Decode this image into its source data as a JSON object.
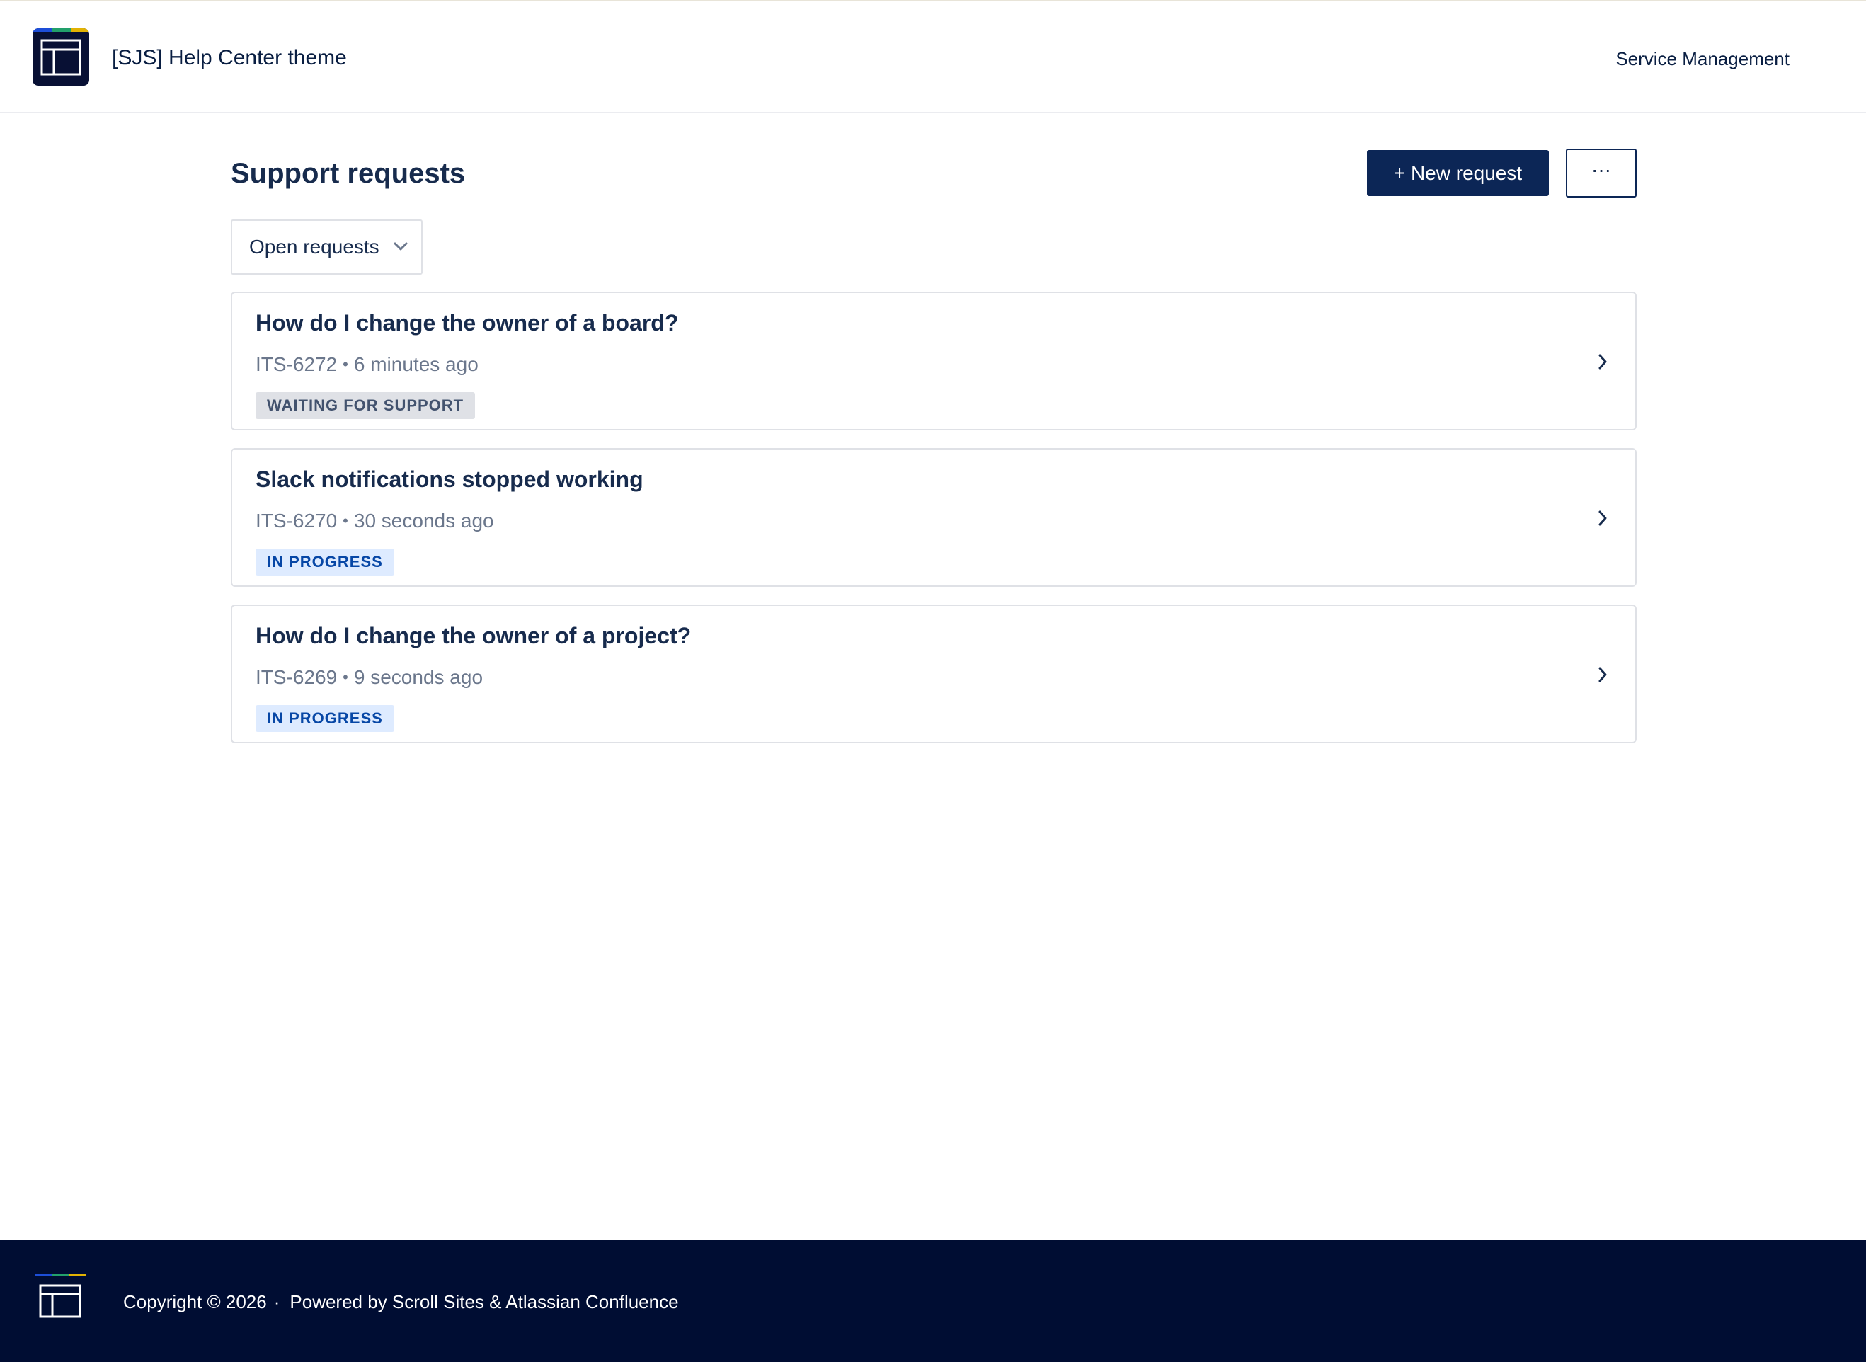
{
  "header": {
    "site_title": "[SJS] Help Center theme",
    "nav_link": "Service Management"
  },
  "main": {
    "page_title": "Support requests",
    "new_request_label": "+ New request",
    "more_label": "···",
    "filter": {
      "selected": "Open requests"
    },
    "requests": [
      {
        "title": "How do I change the owner of a board?",
        "key": "ITS-6272",
        "time": "6 minutes ago",
        "status": "WAITING FOR SUPPORT"
      },
      {
        "title": "Slack notifications stopped working",
        "key": "ITS-6270",
        "time": "30 seconds ago",
        "status": "IN PROGRESS"
      },
      {
        "title": "How do I change the owner of a project?",
        "key": "ITS-6269",
        "time": "9 seconds ago",
        "status": "IN PROGRESS"
      }
    ],
    "separator": "•"
  },
  "footer": {
    "copyright": "Copyright © 2026",
    "separator": "·",
    "powered_by": "Powered by Scroll Sites & Atlassian Confluence"
  },
  "colors": {
    "brand_navy": "#0c2656",
    "logo_bg": "#081034",
    "footer_bg": "#000d33",
    "status_waiting_bg": "#dfe1e6",
    "status_progress_bg": "#deebff",
    "status_progress_text": "#0747a6"
  },
  "icons": {
    "logo": "layout-window-icon",
    "filter": "chevron-down-icon",
    "card": "chevron-right-icon"
  }
}
